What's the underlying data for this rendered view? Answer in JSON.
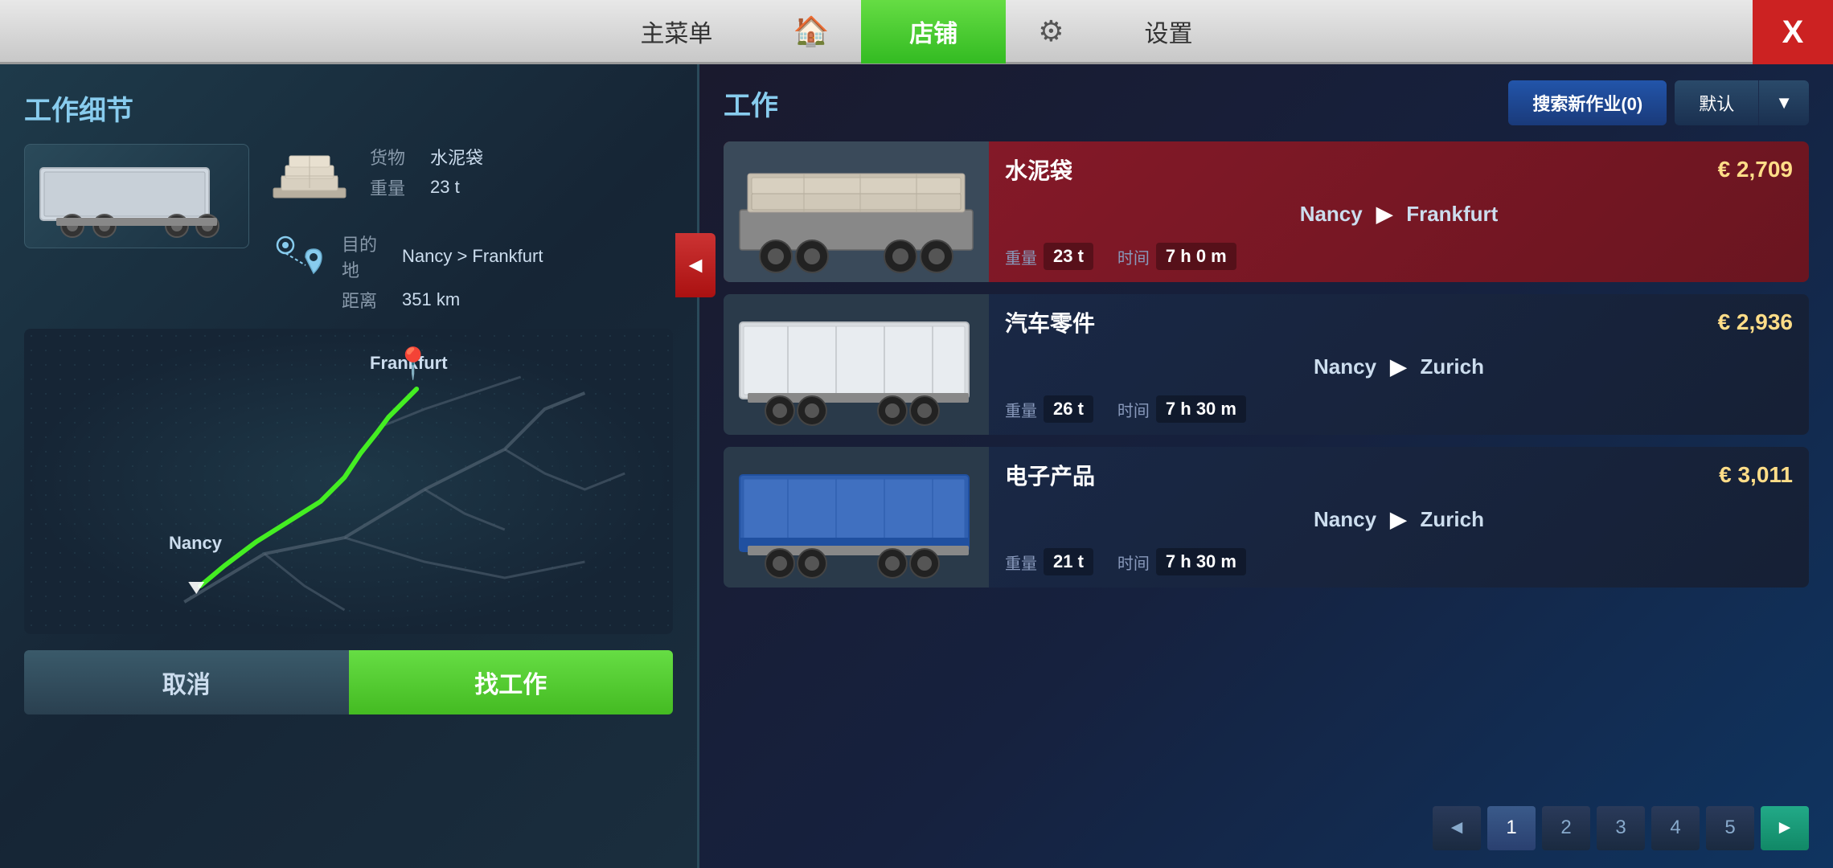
{
  "nav": {
    "main_menu": "主菜单",
    "home_icon": "🏠",
    "shop": "店铺",
    "gear_icon": "⚙",
    "settings": "设置",
    "close": "X"
  },
  "left_panel": {
    "title": "工作细节",
    "cargo_label": "货物",
    "cargo_value": "水泥袋",
    "weight_label": "重量",
    "weight_value": "23 t",
    "destination_label": "目的地",
    "destination_value": "Nancy > Frankfurt",
    "distance_label": "距离",
    "distance_value": "351 km",
    "map_label_nancy": "Nancy",
    "map_label_frankfurt": "Frankfurt",
    "btn_cancel": "取消",
    "btn_find_job": "找工作"
  },
  "right_panel": {
    "title": "工作",
    "search_new": "搜索新作业(0)",
    "default": "默认",
    "jobs": [
      {
        "cargo": "水泥袋",
        "price": "€ 2,709",
        "from": "Nancy",
        "to": "Frankfurt",
        "weight": "23 t",
        "time": "7 h 0 m",
        "weight_label": "重量",
        "time_label": "时间"
      },
      {
        "cargo": "汽车零件",
        "price": "€ 2,936",
        "from": "Nancy",
        "to": "Zurich",
        "weight": "26 t",
        "time": "7 h 30 m",
        "weight_label": "重量",
        "time_label": "时间"
      },
      {
        "cargo": "电子产品",
        "price": "€ 3,011",
        "from": "Nancy",
        "to": "Zurich",
        "weight": "21 t",
        "time": "7 h 30 m",
        "weight_label": "重量",
        "time_label": "时间"
      }
    ],
    "pagination": {
      "prev": "◄",
      "pages": [
        "1",
        "2",
        "3",
        "4",
        "5"
      ],
      "next": "►"
    }
  }
}
